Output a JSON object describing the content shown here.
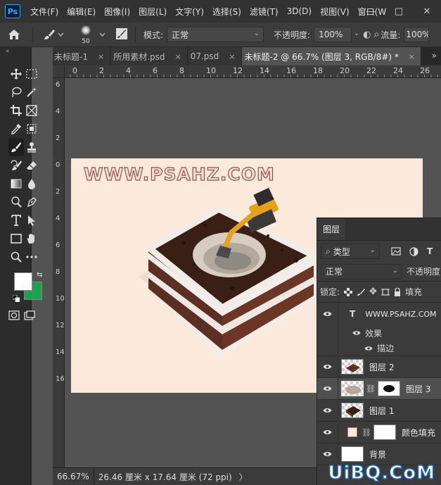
{
  "app": {
    "logo_text": "Ps",
    "menu": [
      "文件(F)",
      "编辑(E)",
      "图像(I)",
      "图层(L)",
      "文字(Y)",
      "选择(S)",
      "滤镜(T)",
      "3D(D)",
      "视图(V)",
      "窗口(W"
    ],
    "window_controls": [
      "—",
      "□",
      "✕"
    ]
  },
  "options": {
    "brush_size": "50",
    "mode_label": "模式:",
    "mode_value": "正常",
    "opacity_label": "不透明度:",
    "opacity_value": "100%",
    "flow_label": "流量:",
    "flow_value": "100%"
  },
  "tabs": {
    "collapse": "«",
    "items": [
      {
        "label": "未标题-1",
        "close": "×"
      },
      {
        "label": "所用素材.psd",
        "close": "×"
      },
      {
        "label": "07.psd",
        "close": "×"
      },
      {
        "label": "未标题-2 @ 66.7% (图层 3, RGB/8#) *",
        "close": "×"
      }
    ],
    "more": "»"
  },
  "rulers": {
    "top": [
      "0",
      "2",
      "4",
      "6",
      "8",
      "10",
      "12",
      "14",
      "16",
      "18",
      "20",
      "22",
      "24",
      "26"
    ],
    "left": [
      "6",
      "4",
      "2",
      "0",
      "2",
      "4",
      "6",
      "8",
      "10",
      "12",
      "14",
      "16"
    ]
  },
  "canvas": {
    "watermark": "WWW.PSAHZ.COM",
    "background": "#fbeadc"
  },
  "colors": {
    "foreground": "#ffffff",
    "background": "#1da34b"
  },
  "status": {
    "zoom": "66.67%",
    "info": "26.46 厘米 x 17.64 厘米 (72 ppi)",
    "caret": "〉"
  },
  "layers": {
    "title": "图层",
    "filter_type": "类型",
    "blend_mode": "正常",
    "opacity_label": "不透明度",
    "lock_label": "锁定:",
    "fill_label": "填充",
    "text_layer": "WWW.PSAHZ.COM",
    "effects_label": "效果",
    "stroke_label": "描边",
    "items": [
      {
        "name": "图层 2"
      },
      {
        "name": "图层 3"
      },
      {
        "name": "图层 1"
      },
      {
        "name": "颜色填充"
      },
      {
        "name": "背景"
      }
    ]
  },
  "site_watermark": "UiBQ.CoM"
}
